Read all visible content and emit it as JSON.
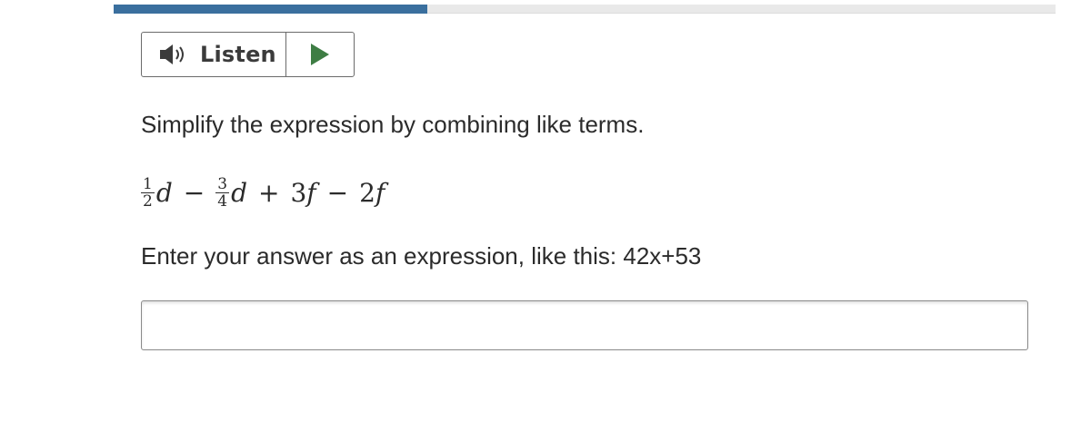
{
  "progress": {
    "fraction": 0.333,
    "fill_color": "#3a6f9e",
    "track_color": "#e9e9e9"
  },
  "listen": {
    "label": "Listen",
    "speaker_icon": "speaker-icon",
    "play_icon": "play-icon",
    "play_color": "#3e7d44"
  },
  "question": {
    "instruction": "Simplify the expression by combining like terms.",
    "expression": {
      "term1_num": "1",
      "term1_den": "2",
      "term1_var": "d",
      "op1": "−",
      "term2_num": "3",
      "term2_den": "4",
      "term2_var": "d",
      "op2": "+",
      "term3": "3",
      "term3_var": "f",
      "op3": "−",
      "term4": "2",
      "term4_var": "f"
    },
    "hint": "Enter your answer as an expression, like this: 42x+53"
  },
  "answer": {
    "value": "",
    "placeholder": ""
  }
}
